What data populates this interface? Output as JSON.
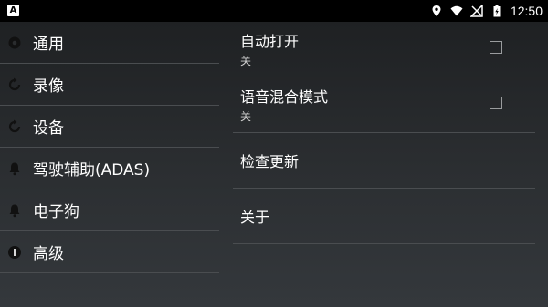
{
  "status_bar": {
    "app_badge": "A",
    "time": "12:50"
  },
  "sidebar": {
    "items": [
      {
        "label": "通用",
        "icon": "settings-icon"
      },
      {
        "label": "录像",
        "icon": "refresh-icon"
      },
      {
        "label": "设备",
        "icon": "refresh-icon"
      },
      {
        "label": "驾驶辅助(ADAS)",
        "icon": "bell-icon"
      },
      {
        "label": "电子狗",
        "icon": "bell-icon"
      },
      {
        "label": "高级",
        "icon": "info-icon"
      }
    ]
  },
  "settings": {
    "auto_open": {
      "title": "自动打开",
      "value": "关",
      "checked": false
    },
    "audio_mix": {
      "title": "语音混合模式",
      "value": "关",
      "checked": false
    },
    "check_update": {
      "title": "检查更新"
    },
    "about": {
      "title": "关于"
    }
  },
  "colors": {
    "background_top": "#1d1f21",
    "background_bottom": "#34383c",
    "divider": "#4a4d50",
    "text": "#ffffff",
    "subtext": "#cfcfcf"
  }
}
